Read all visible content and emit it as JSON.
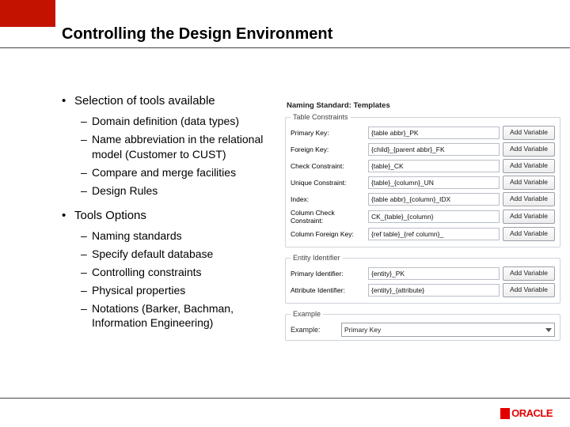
{
  "title": "Controlling the Design Environment",
  "bullets": {
    "b1": "Selection of tools available",
    "b1_items": [
      "Domain definition (data types)",
      "Name abbreviation in the relational model (Customer to CUST)",
      "Compare and merge facilities",
      "Design Rules"
    ],
    "b2": "Tools Options",
    "b2_items": [
      "Naming standards",
      "Specify default database",
      "Controlling constraints",
      "Physical properties",
      "Notations (Barker, Bachman, Information Engineering)"
    ]
  },
  "panel": {
    "title": "Naming Standard: Templates",
    "table_constraints_legend": "Table Constraints",
    "entity_identifier_legend": "Entity Identifier",
    "example_legend": "Example",
    "add_variable_label": "Add Variable",
    "rows_tc": [
      {
        "label": "Primary Key:",
        "value": "{table abbr}_PK"
      },
      {
        "label": "Foreign Key:",
        "value": "{child}_{parent abbr}_FK"
      },
      {
        "label": "Check Constraint:",
        "value": "{table}_CK"
      },
      {
        "label": "Unique Constraint:",
        "value": "{table}_{column}_UN"
      },
      {
        "label": "Index:",
        "value": "{table abbr}_{column}_IDX"
      },
      {
        "label": "Column Check Constraint:",
        "value": "CK_{table}_{column}"
      },
      {
        "label": "Column Foreign Key:",
        "value": "{ref table}_{ref column}_"
      }
    ],
    "rows_ei": [
      {
        "label": "Primary Identifier:",
        "value": "{entity}_PK"
      },
      {
        "label": "Attribute Identifier:",
        "value": "{entity}_{attribute}"
      }
    ],
    "example_label": "Example:",
    "example_value": "Primary Key"
  },
  "logo_text": "ORACLE"
}
